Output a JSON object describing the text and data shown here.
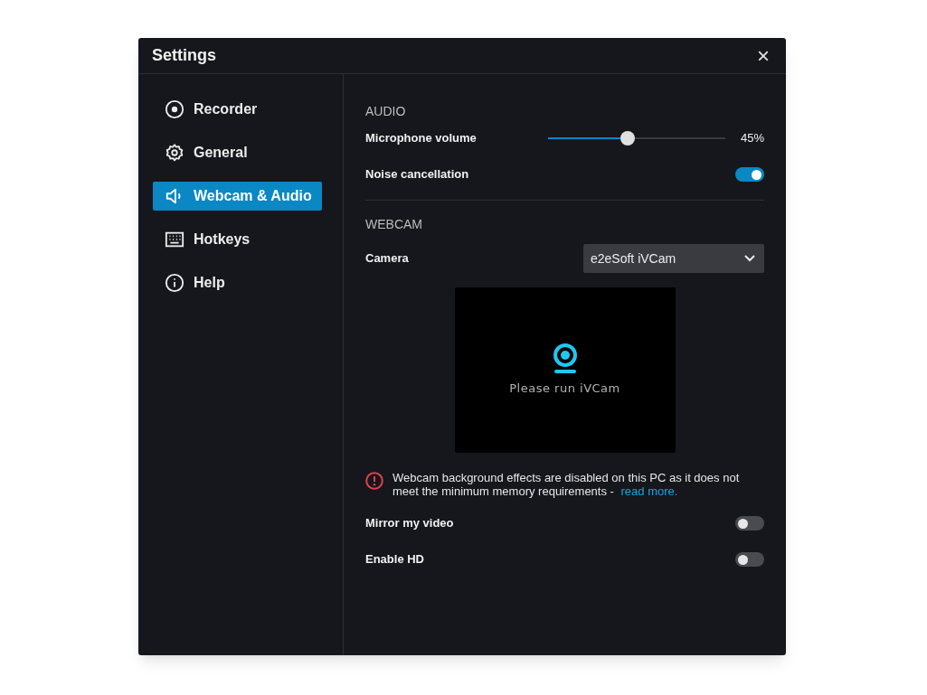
{
  "window": {
    "title": "Settings",
    "close": "×"
  },
  "sidebar": {
    "items": [
      {
        "kind": "record",
        "label": "Recorder",
        "selected": false
      },
      {
        "kind": "gear",
        "label": "General",
        "selected": false
      },
      {
        "kind": "speaker",
        "label": "Webcam & Audio",
        "selected": true
      },
      {
        "kind": "keyboard",
        "label": "Hotkeys",
        "selected": false
      },
      {
        "kind": "info",
        "label": "Help",
        "selected": false
      }
    ]
  },
  "audio": {
    "heading": "AUDIO",
    "rows": [
      {
        "kind": "slider",
        "label": "Microphone volume",
        "level": 0.45,
        "reading": "45%"
      },
      {
        "kind": "toggle",
        "label": "Noise cancellation",
        "on": true
      }
    ]
  },
  "webcam": {
    "heading": "WEBCAM",
    "camera": {
      "label": "Camera",
      "value": "e2eSoft iVCam"
    },
    "preview": {
      "message": "Please run iVCam"
    },
    "warning": {
      "text": "Webcam background effects are disabled on this PC as it does not meet the minimum memory requirements - ",
      "link": "read more."
    },
    "rows": [
      {
        "kind": "toggle",
        "label": "Mirror my video",
        "on": false
      },
      {
        "kind": "toggle",
        "label": "Enable HD",
        "on": false
      }
    ]
  }
}
